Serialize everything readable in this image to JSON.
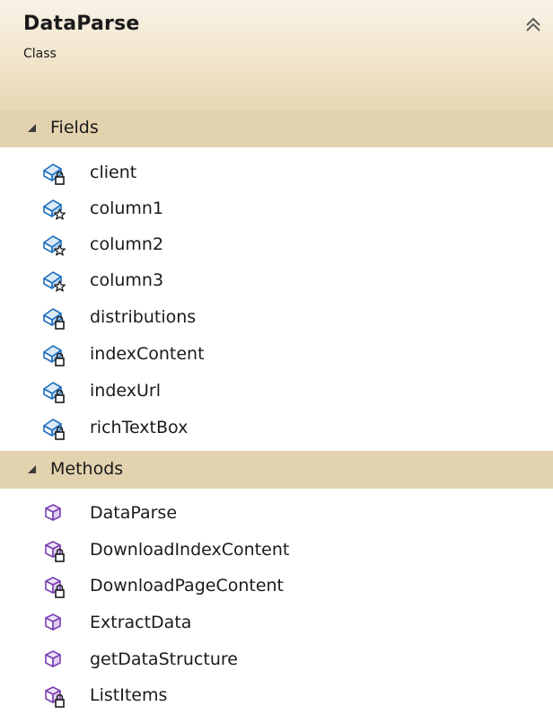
{
  "class": {
    "name": "DataParse",
    "kind": "Class"
  },
  "colors": {
    "header_gradient_top": "#f9f3e7",
    "header_gradient_bottom": "#e8d7b4",
    "section_bg": "#e3d2ae",
    "field_icon": "#1f6fbf",
    "method_icon": "#7a3fb5"
  },
  "sections": {
    "fields": {
      "label": "Fields",
      "items": [
        {
          "name": "client",
          "icon": "private-field-icon"
        },
        {
          "name": "column1",
          "icon": "friend-field-icon"
        },
        {
          "name": "column2",
          "icon": "friend-field-icon"
        },
        {
          "name": "column3",
          "icon": "friend-field-icon"
        },
        {
          "name": "distributions",
          "icon": "private-field-icon"
        },
        {
          "name": "indexContent",
          "icon": "private-field-icon"
        },
        {
          "name": "indexUrl",
          "icon": "private-field-icon"
        },
        {
          "name": "richTextBox",
          "icon": "private-field-icon"
        }
      ]
    },
    "methods": {
      "label": "Methods",
      "items": [
        {
          "name": "DataParse",
          "icon": "public-method-icon"
        },
        {
          "name": "DownloadIndexContent",
          "icon": "private-method-icon"
        },
        {
          "name": "DownloadPageContent",
          "icon": "private-method-icon"
        },
        {
          "name": "ExtractData",
          "icon": "public-method-icon"
        },
        {
          "name": "getDataStructure",
          "icon": "public-method-icon"
        },
        {
          "name": "ListItems",
          "icon": "private-method-icon"
        }
      ]
    }
  }
}
